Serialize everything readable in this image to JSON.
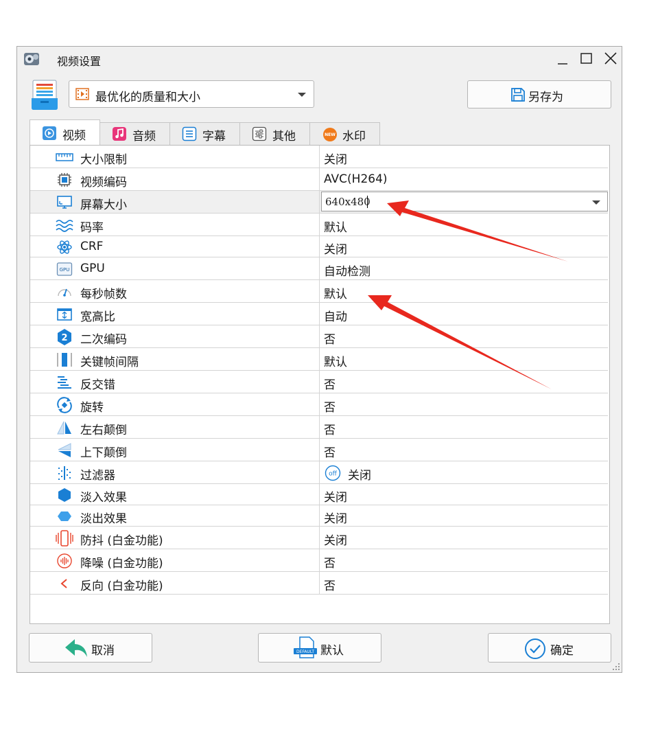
{
  "window": {
    "title": "视频设置"
  },
  "preset": {
    "selected": "最优化的质量和大小",
    "save_as_label": "另存为"
  },
  "tabs": [
    {
      "label": "视频",
      "active": true
    },
    {
      "label": "音频"
    },
    {
      "label": "字幕"
    },
    {
      "label": "其他"
    },
    {
      "label": "水印",
      "badge": "NEW"
    }
  ],
  "settings": [
    {
      "name": "大小限制",
      "value": "关闭",
      "icon": "ruler-icon"
    },
    {
      "name": "视频编码",
      "value": "AVC(H264)",
      "icon": "chip-icon"
    },
    {
      "name": "屏幕大小",
      "value": "640x480",
      "icon": "monitor-icon",
      "editing": true
    },
    {
      "name": "码率",
      "value": "默认",
      "icon": "waves-icon"
    },
    {
      "name": "CRF",
      "value": "关闭",
      "icon": "atom-icon"
    },
    {
      "name": "GPU",
      "value": "自动检测",
      "icon": "gpu-icon"
    },
    {
      "name": "每秒帧数",
      "value": "默认",
      "icon": "speedometer-icon"
    },
    {
      "name": "宽高比",
      "value": "自动",
      "icon": "aspect-ratio-icon"
    },
    {
      "name": "二次编码",
      "value": "否",
      "icon": "two-pass-icon"
    },
    {
      "name": "关键帧间隔",
      "value": "默认",
      "icon": "keyframe-icon"
    },
    {
      "name": "反交错",
      "value": "否",
      "icon": "deinterlace-icon"
    },
    {
      "name": "旋转",
      "value": "否",
      "icon": "rotate-icon"
    },
    {
      "name": "左右颠倒",
      "value": "否",
      "icon": "flip-horizontal-icon"
    },
    {
      "name": "上下颠倒",
      "value": "否",
      "icon": "flip-vertical-icon"
    },
    {
      "name": "过滤器",
      "value": "关闭",
      "icon": "filter-icon",
      "badge": "off"
    },
    {
      "name": "淡入效果",
      "value": "关闭",
      "icon": "fade-in-icon"
    },
    {
      "name": "淡出效果",
      "value": "关闭",
      "icon": "fade-out-icon"
    },
    {
      "name": "防抖 (白金功能)",
      "value": "关闭",
      "icon": "stabilize-icon"
    },
    {
      "name": "降噪 (白金功能)",
      "value": "否",
      "icon": "denoise-icon"
    },
    {
      "name": "反向 (白金功能)",
      "value": "否",
      "icon": "reverse-icon"
    }
  ],
  "buttons": {
    "cancel": "取消",
    "default": "默认",
    "default_icon_text": "DEFAULT",
    "ok": "确定"
  },
  "colors": {
    "accent": "#1a7fd4",
    "annotation_arrow": "#e8281e"
  }
}
